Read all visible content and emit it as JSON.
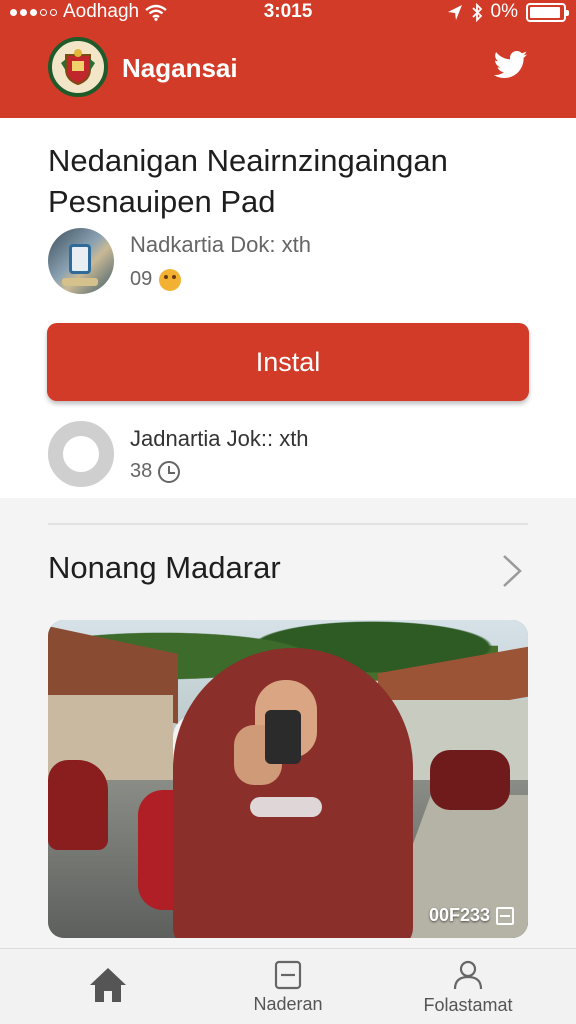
{
  "status_bar": {
    "carrier": "Aodhagh",
    "time": "3:015",
    "battery": "0%",
    "icons": [
      "signal-dots-icon",
      "wifi-icon",
      "location-arrow-icon",
      "bluetooth-icon",
      "battery-icon"
    ]
  },
  "header": {
    "app_name": "Nagansai",
    "logo_icon": "crest-logo-icon",
    "share_icon": "twitter-icon",
    "background_color": "#d23b27"
  },
  "article": {
    "title": "Nedanigan Neairnzingaingan Pesnauipen Pad",
    "author_line": "Nadkartia Dok: xth",
    "author_count": "09",
    "author_count_icon": "emoji-face-icon",
    "install_label": "Instal",
    "second_author_line": "Jadnartia Jok:: xth",
    "second_count": "38",
    "second_count_icon": "clock-icon"
  },
  "section": {
    "title": "Nonang Madarar",
    "chevron_icon": "chevron-right-icon"
  },
  "photo": {
    "stamp_text": "00F233",
    "stamp_icon": "square-icon"
  },
  "bottom_nav": {
    "items": [
      {
        "label": "",
        "icon": "home-icon"
      },
      {
        "label": "Naderan",
        "icon": "news-icon"
      },
      {
        "label": "Folastamat",
        "icon": "profile-icon"
      }
    ]
  },
  "colors": {
    "accent": "#d23b27",
    "background": "#f4f4f4",
    "card": "#ffffff"
  }
}
